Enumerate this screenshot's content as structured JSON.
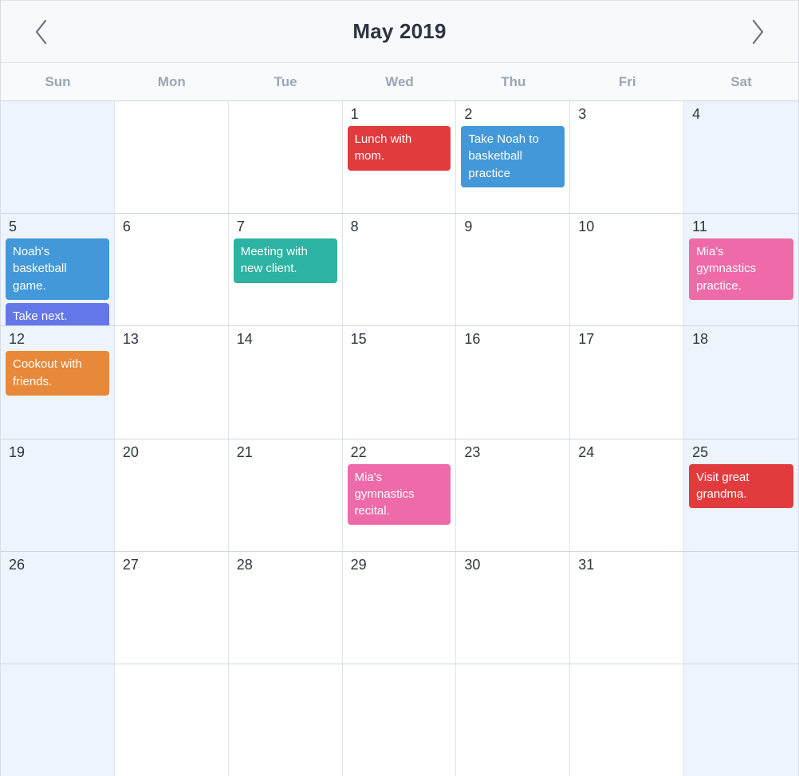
{
  "toolbar": {
    "prev_label": "chevron-left",
    "next_label": "chevron-right",
    "title": "May 2019"
  },
  "weekdays": [
    "Sun",
    "Mon",
    "Tue",
    "Wed",
    "Thu",
    "Fri",
    "Sat"
  ],
  "colors": {
    "red": "#e23b3e",
    "blue": "#4298d8",
    "teal": "#2cb3a3",
    "pink": "#ef6aa9",
    "orange": "#e8883a",
    "indigo": "#6477e8",
    "weekend_bg": "#edf4fc",
    "toolbar_bg": "#f7f9fb",
    "grid_line": "#dde4ec",
    "weekday_text": "#9aa6b5",
    "day_number_text": "#2f3640"
  },
  "weeks": [
    {
      "days": [
        {
          "number": "",
          "weekend": true,
          "events": []
        },
        {
          "number": "",
          "weekend": false,
          "events": []
        },
        {
          "number": "",
          "weekend": false,
          "events": []
        },
        {
          "number": "1",
          "weekend": false,
          "events": [
            {
              "title": "Lunch with mom.",
              "color": "#e23b3e"
            }
          ]
        },
        {
          "number": "2",
          "weekend": false,
          "events": [
            {
              "title": "Take Noah to basketball practice",
              "color": "#4298d8"
            }
          ]
        },
        {
          "number": "3",
          "weekend": false,
          "events": []
        },
        {
          "number": "4",
          "weekend": true,
          "events": []
        }
      ]
    },
    {
      "days": [
        {
          "number": "5",
          "weekend": true,
          "events": [
            {
              "title": "Noah's basketball game.",
              "color": "#4298d8"
            },
            {
              "title": "Take next.",
              "color": "#6477e8"
            }
          ]
        },
        {
          "number": "6",
          "weekend": false,
          "events": []
        },
        {
          "number": "7",
          "weekend": false,
          "events": [
            {
              "title": "Meeting with new client.",
              "color": "#2cb3a3"
            }
          ]
        },
        {
          "number": "8",
          "weekend": false,
          "events": []
        },
        {
          "number": "9",
          "weekend": false,
          "events": []
        },
        {
          "number": "10",
          "weekend": false,
          "events": []
        },
        {
          "number": "11",
          "weekend": true,
          "events": [
            {
              "title": "Mia's gymnastics practice.",
              "color": "#ef6aa9"
            }
          ]
        }
      ]
    },
    {
      "days": [
        {
          "number": "12",
          "weekend": true,
          "events": [
            {
              "title": "Cookout with friends.",
              "color": "#e8883a"
            }
          ]
        },
        {
          "number": "13",
          "weekend": false,
          "events": []
        },
        {
          "number": "14",
          "weekend": false,
          "events": []
        },
        {
          "number": "15",
          "weekend": false,
          "events": []
        },
        {
          "number": "16",
          "weekend": false,
          "events": []
        },
        {
          "number": "17",
          "weekend": false,
          "events": []
        },
        {
          "number": "18",
          "weekend": true,
          "events": []
        }
      ]
    },
    {
      "days": [
        {
          "number": "19",
          "weekend": true,
          "events": []
        },
        {
          "number": "20",
          "weekend": false,
          "events": []
        },
        {
          "number": "21",
          "weekend": false,
          "events": []
        },
        {
          "number": "22",
          "weekend": false,
          "events": [
            {
              "title": "Mia's gymnastics recital.",
              "color": "#ef6aa9"
            }
          ]
        },
        {
          "number": "23",
          "weekend": false,
          "events": []
        },
        {
          "number": "24",
          "weekend": false,
          "events": []
        },
        {
          "number": "25",
          "weekend": true,
          "events": [
            {
              "title": "Visit great grandma.",
              "color": "#e23b3e"
            }
          ]
        }
      ]
    },
    {
      "days": [
        {
          "number": "26",
          "weekend": true,
          "events": []
        },
        {
          "number": "27",
          "weekend": false,
          "events": []
        },
        {
          "number": "28",
          "weekend": false,
          "events": []
        },
        {
          "number": "29",
          "weekend": false,
          "events": []
        },
        {
          "number": "30",
          "weekend": false,
          "events": []
        },
        {
          "number": "31",
          "weekend": false,
          "events": []
        },
        {
          "number": "",
          "weekend": true,
          "events": []
        }
      ]
    },
    {
      "days": [
        {
          "number": "",
          "weekend": true,
          "events": []
        },
        {
          "number": "",
          "weekend": false,
          "events": []
        },
        {
          "number": "",
          "weekend": false,
          "events": []
        },
        {
          "number": "",
          "weekend": false,
          "events": []
        },
        {
          "number": "",
          "weekend": false,
          "events": []
        },
        {
          "number": "",
          "weekend": false,
          "events": []
        },
        {
          "number": "",
          "weekend": true,
          "events": []
        }
      ]
    }
  ]
}
